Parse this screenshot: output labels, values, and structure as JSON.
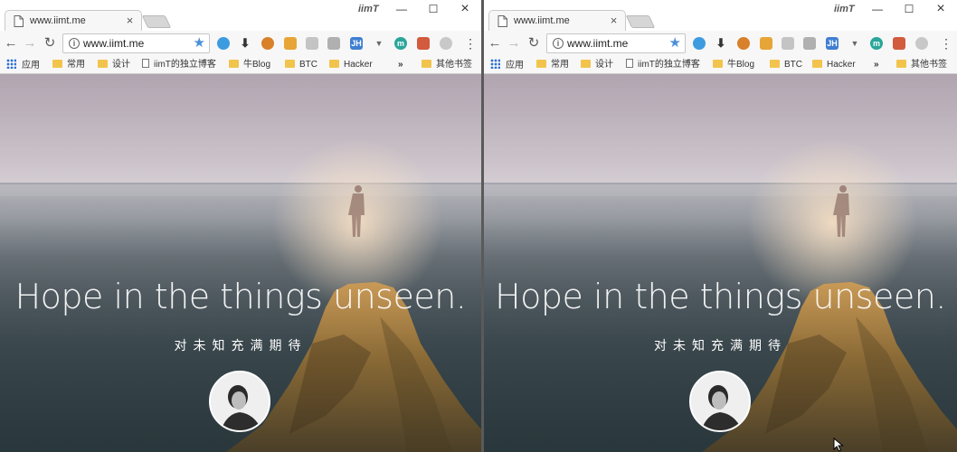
{
  "windows": [
    {
      "tab": {
        "title": "www.iimt.me"
      },
      "profile": "iimT",
      "address": {
        "url": "www.iimt.me"
      },
      "bookmarks": {
        "apps": "应用",
        "items": [
          "常用",
          "设计",
          "iimT的独立博客",
          "牛Blog",
          "BTC",
          "Hacker"
        ],
        "overflow": "»",
        "other": "其他书签"
      },
      "page": {
        "headline": "Hope in the things unseen.",
        "subline": "对未知充满期待"
      }
    },
    {
      "tab": {
        "title": "www.iimt.me"
      },
      "profile": "iimT",
      "address": {
        "url": "www.iimt.me"
      },
      "bookmarks": {
        "apps": "应用",
        "items": [
          "常用",
          "设计",
          "iimT的独立博客",
          "牛Blog",
          "BTC",
          "Hacker"
        ],
        "overflow": "»",
        "other": "其他书签"
      },
      "page": {
        "headline": "Hope in the things unseen.",
        "subline": "对未知充满期待"
      }
    }
  ],
  "icons": {
    "close": "×",
    "minimize": "—",
    "maximize": "☐",
    "back": "←",
    "forward": "→",
    "reload": "↻",
    "info": "i",
    "star": "★",
    "menu": "⋮"
  },
  "colors": {
    "star": "#4a90d9",
    "folder": "#f2c44d"
  }
}
